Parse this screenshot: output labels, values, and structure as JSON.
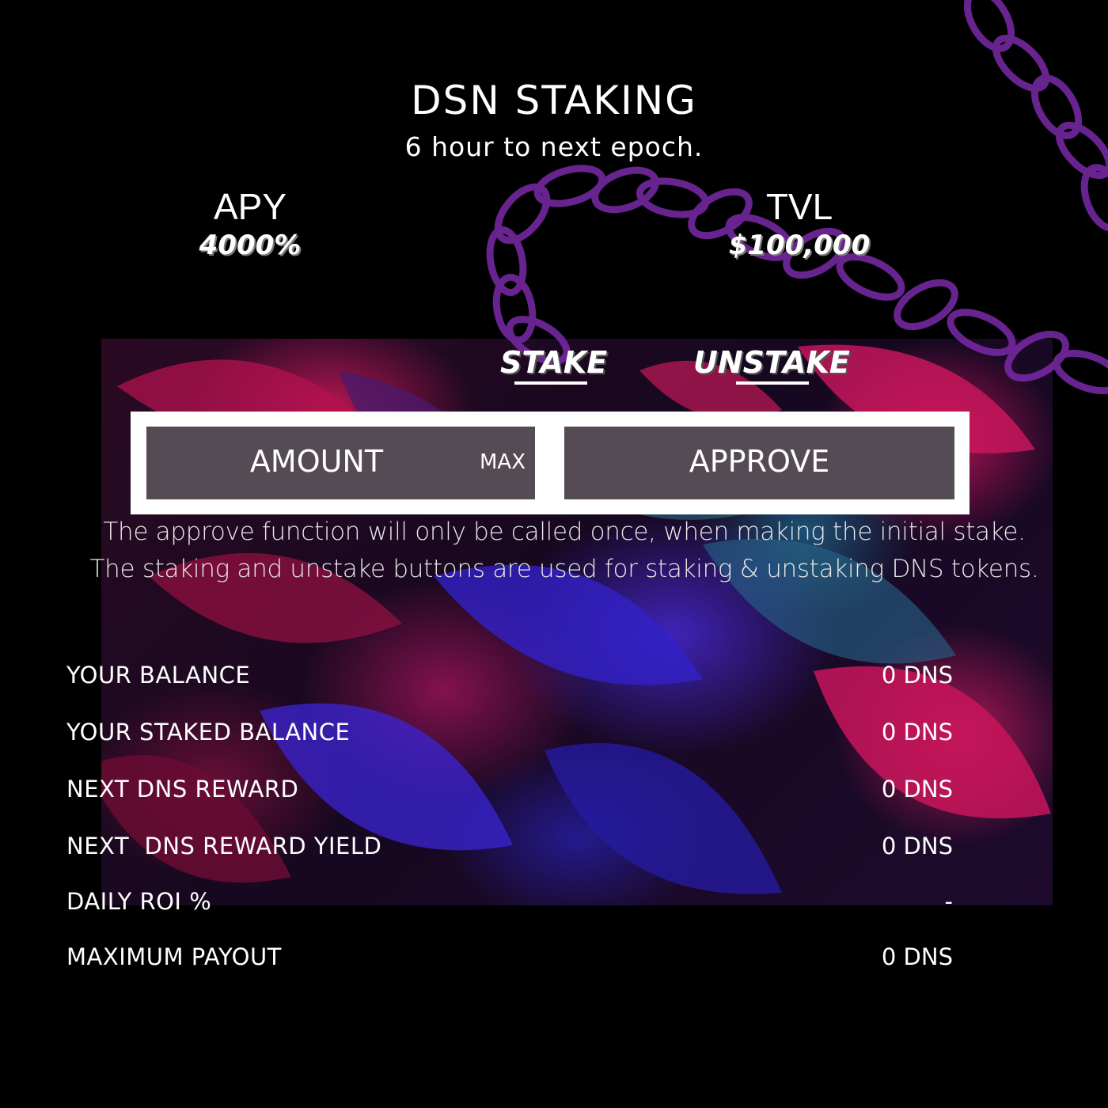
{
  "header": {
    "title": "DSN STAKING",
    "subtitle": "6 hour to next epoch."
  },
  "stats": {
    "apy": {
      "label": "APY",
      "value": "4000%"
    },
    "tvl": {
      "label": "TVL",
      "value": "$100,000"
    }
  },
  "tabs": {
    "stake_label": "STAKE",
    "unstake_label": "UNSTAKE"
  },
  "form": {
    "amount_placeholder": "AMOUNT",
    "max_label": "MAX",
    "approve_label": "APPROVE"
  },
  "notes": [
    "The approve function will only be called once, when making the initial stake.",
    "The staking and unstake buttons are used for staking & unstaking DNS tokens."
  ],
  "rows": [
    {
      "label": "YOUR BALANCE",
      "value": "0 DNS"
    },
    {
      "label": "YOUR STAKED BALANCE",
      "value": "0 DNS"
    },
    {
      "label": "NEXT DNS REWARD",
      "value": "0 DNS"
    },
    {
      "label": "NEXT  DNS REWARD YIELD",
      "value": "0 DNS"
    },
    {
      "label": "DAILY ROI %",
      "value": "-"
    },
    {
      "label": "MAXIMUM PAYOUT",
      "value": "0 DNS"
    }
  ],
  "colors": {
    "background": "#000000",
    "text": "#ffffff",
    "chain": "#7a2aa8",
    "leaf_pink": "#d81b60",
    "leaf_blue": "#3a2bd0"
  },
  "icons": {
    "chain": "chain-decoration",
    "leaves": "leaf-background"
  }
}
